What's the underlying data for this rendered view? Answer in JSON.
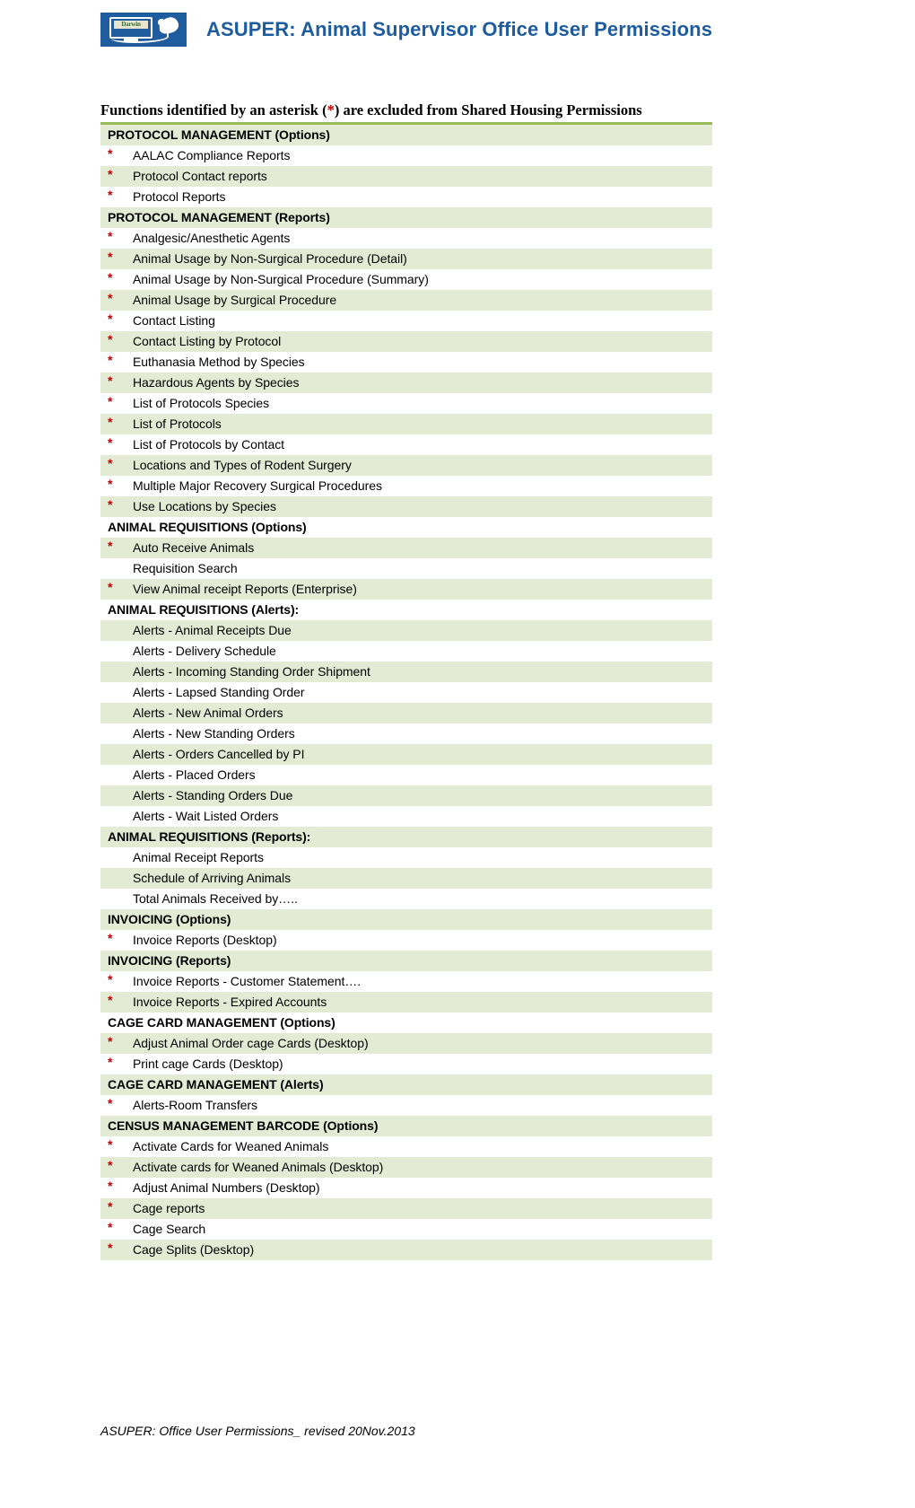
{
  "header": {
    "title": "ASUPER: Animal Supervisor Office User Permissions",
    "logo_brand_text": "Darwin",
    "accent_color": "#1F5C9E"
  },
  "intro": {
    "before": "Functions identified by an asterisk (",
    "star": "*",
    "after": ") are excluded from Shared Housing Permissions"
  },
  "colors": {
    "shade": "#E4EBD4",
    "rule": "#9BBB59",
    "asterisk": "#C00000",
    "title": "#1F5C9E"
  },
  "rows": [
    {
      "kind": "section",
      "label": "PROTOCOL MANAGEMENT (Options)",
      "shaded": true
    },
    {
      "kind": "item",
      "star": true,
      "label": "AALAC  Compliance Reports",
      "shaded": false
    },
    {
      "kind": "item",
      "star": true,
      "label": "Protocol Contact reports",
      "shaded": true
    },
    {
      "kind": "item",
      "star": true,
      "label": "Protocol Reports",
      "shaded": false
    },
    {
      "kind": "section",
      "label": "PROTOCOL MANAGEMENT (Reports)",
      "shaded": true
    },
    {
      "kind": "item",
      "star": true,
      "label": "Analgesic/Anesthetic Agents",
      "shaded": false
    },
    {
      "kind": "item",
      "star": true,
      "label": "Animal Usage by Non-Surgical Procedure (Detail)",
      "shaded": true
    },
    {
      "kind": "item",
      "star": true,
      "label": "Animal Usage by Non-Surgical Procedure (Summary)",
      "shaded": false
    },
    {
      "kind": "item",
      "star": true,
      "label": "Animal Usage by Surgical Procedure",
      "shaded": true
    },
    {
      "kind": "item",
      "star": true,
      "label": "Contact Listing",
      "shaded": false
    },
    {
      "kind": "item",
      "star": true,
      "label": "Contact Listing by Protocol",
      "shaded": true
    },
    {
      "kind": "item",
      "star": true,
      "label": "Euthanasia Method by Species",
      "shaded": false
    },
    {
      "kind": "item",
      "star": true,
      "label": "Hazardous Agents by Species",
      "shaded": true
    },
    {
      "kind": "item",
      "star": true,
      "label": "List of Protocols Species",
      "shaded": false
    },
    {
      "kind": "item",
      "star": true,
      "label": "List of Protocols",
      "shaded": true
    },
    {
      "kind": "item",
      "star": true,
      "label": "List of Protocols by Contact",
      "shaded": false
    },
    {
      "kind": "item",
      "star": true,
      "label": "Locations and Types of Rodent Surgery",
      "shaded": true
    },
    {
      "kind": "item",
      "star": true,
      "label": "Multiple Major Recovery Surgical Procedures",
      "shaded": false
    },
    {
      "kind": "item",
      "star": true,
      "label": "Use Locations by Species",
      "shaded": true
    },
    {
      "kind": "section",
      "label": "ANIMAL REQUISITIONS (Options)",
      "shaded": false
    },
    {
      "kind": "item",
      "star": true,
      "label": "Auto Receive Animals",
      "shaded": true
    },
    {
      "kind": "item",
      "star": false,
      "label": "Requisition Search",
      "shaded": false
    },
    {
      "kind": "item",
      "star": true,
      "label": "View Animal receipt Reports (Enterprise)",
      "shaded": true
    },
    {
      "kind": "section",
      "label": "ANIMAL REQUISITIONS (Alerts):",
      "shaded": false
    },
    {
      "kind": "item",
      "star": false,
      "label": "Alerts - Animal Receipts Due",
      "shaded": true
    },
    {
      "kind": "item",
      "star": false,
      "label": "Alerts - Delivery Schedule",
      "shaded": false
    },
    {
      "kind": "item",
      "star": false,
      "label": "Alerts - Incoming Standing Order Shipment",
      "shaded": true
    },
    {
      "kind": "item",
      "star": false,
      "label": "Alerts - Lapsed Standing Order",
      "shaded": false
    },
    {
      "kind": "item",
      "star": false,
      "label": "Alerts - New Animal Orders",
      "shaded": true
    },
    {
      "kind": "item",
      "star": false,
      "label": "Alerts - New Standing Orders",
      "shaded": false
    },
    {
      "kind": "item",
      "star": false,
      "label": "Alerts - Orders Cancelled by PI",
      "shaded": true
    },
    {
      "kind": "item",
      "star": false,
      "label": "Alerts - Placed Orders",
      "shaded": false
    },
    {
      "kind": "item",
      "star": false,
      "label": "Alerts - Standing Orders Due",
      "shaded": true
    },
    {
      "kind": "item",
      "star": false,
      "label": "Alerts - Wait Listed Orders",
      "shaded": false
    },
    {
      "kind": "section",
      "label": "ANIMAL REQUISITIONS (Reports):",
      "shaded": true
    },
    {
      "kind": "item",
      "star": false,
      "label": "Animal Receipt Reports",
      "shaded": false
    },
    {
      "kind": "item",
      "star": false,
      "label": "Schedule of Arriving Animals",
      "shaded": true
    },
    {
      "kind": "item",
      "star": false,
      "label": "Total Animals Received by…..",
      "shaded": false
    },
    {
      "kind": "section",
      "label": "INVOICING (Options)",
      "shaded": true
    },
    {
      "kind": "item",
      "star": true,
      "label": "Invoice Reports (Desktop)",
      "shaded": false
    },
    {
      "kind": "section",
      "label": "INVOICING (Reports)",
      "shaded": true
    },
    {
      "kind": "item",
      "star": true,
      "label": "Invoice Reports - Customer Statement….",
      "shaded": false
    },
    {
      "kind": "item",
      "star": true,
      "label": "Invoice Reports - Expired Accounts",
      "shaded": true
    },
    {
      "kind": "section",
      "label": "CAGE CARD MANAGEMENT (Options)",
      "shaded": false
    },
    {
      "kind": "item",
      "star": true,
      "label": "Adjust Animal Order cage Cards (Desktop)",
      "shaded": true
    },
    {
      "kind": "item",
      "star": true,
      "label": "Print cage Cards (Desktop)",
      "shaded": false
    },
    {
      "kind": "section",
      "label": "CAGE CARD MANAGEMENT (Alerts)",
      "shaded": true
    },
    {
      "kind": "item",
      "star": true,
      "label": "Alerts-Room Transfers",
      "shaded": false
    },
    {
      "kind": "section",
      "label": "CENSUS MANAGEMENT BARCODE (Options)",
      "shaded": true
    },
    {
      "kind": "item",
      "star": true,
      "label": "Activate Cards for Weaned Animals",
      "shaded": false
    },
    {
      "kind": "item",
      "star": true,
      "label": "Activate cards for Weaned Animals (Desktop)",
      "shaded": true
    },
    {
      "kind": "item",
      "star": true,
      "label": "Adjust Animal Numbers (Desktop)",
      "shaded": false
    },
    {
      "kind": "item",
      "star": true,
      "label": "Cage reports",
      "shaded": true
    },
    {
      "kind": "item",
      "star": true,
      "label": "Cage Search",
      "shaded": false
    },
    {
      "kind": "item",
      "star": true,
      "label": "Cage Splits (Desktop)",
      "shaded": true
    }
  ],
  "footer": {
    "text": "ASUPER: Office User Permissions_ revised 20Nov.2013"
  }
}
